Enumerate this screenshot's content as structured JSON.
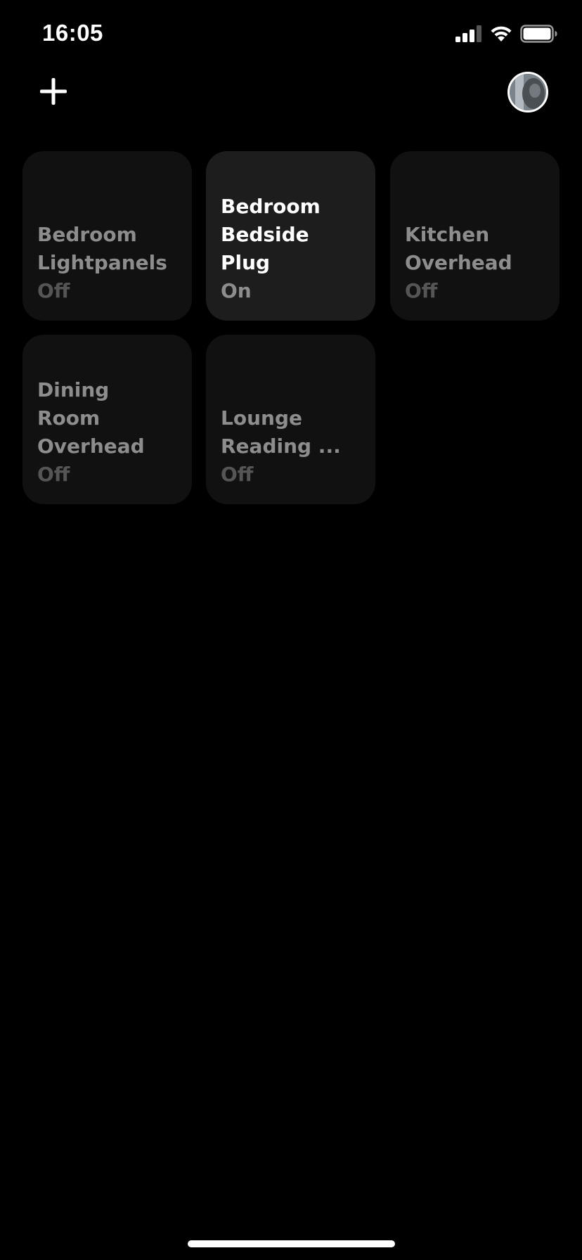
{
  "status_bar": {
    "time": "16:05",
    "icons": [
      "cellular-signal-icon",
      "wifi-icon",
      "battery-icon"
    ]
  },
  "top_bar": {
    "add_icon": "plus-icon",
    "avatar": "profile-avatar"
  },
  "tiles": [
    {
      "name": "Bedroom\nLightpanels",
      "state": "Off",
      "on": false
    },
    {
      "name": "Bedroom\nBedside Plug",
      "state": "On",
      "on": true
    },
    {
      "name": "Kitchen\nOverhead",
      "state": "Off",
      "on": false
    },
    {
      "name": "Dining Room\nOverhead",
      "state": "Off",
      "on": false
    },
    {
      "name": "Lounge\nReading ...",
      "state": "Off",
      "on": false
    }
  ],
  "colors": {
    "background": "#000000",
    "tile_off": "#111111",
    "tile_on": "#1d1d1d",
    "text_on": "#ffffff",
    "text_off": "#8d8d8d",
    "state_off": "#555555"
  }
}
